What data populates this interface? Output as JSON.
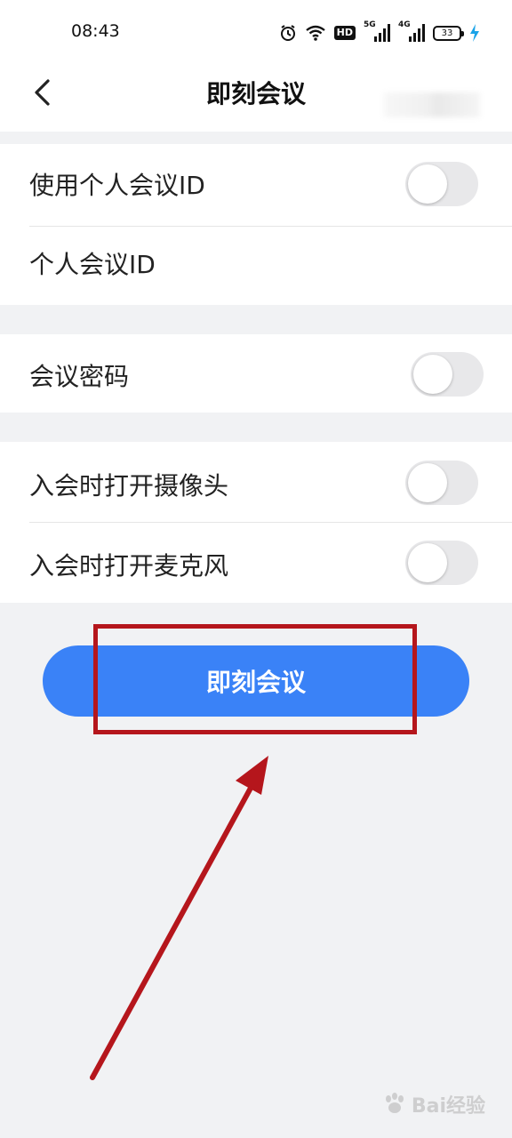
{
  "status_bar": {
    "time": "08:43",
    "hd_label": "HD",
    "signal_1_label": "5G",
    "signal_2_label": "4G",
    "battery_level": "33"
  },
  "navbar": {
    "title": "即刻会议"
  },
  "settings": {
    "use_personal_id_label": "使用个人会议ID",
    "use_personal_id_on": false,
    "personal_id_label": "个人会议ID",
    "password_label": "会议密码",
    "password_on": false,
    "camera_label": "入会时打开摄像头",
    "camera_on": false,
    "mic_label": "入会时打开麦克风",
    "mic_on": false
  },
  "start_button": {
    "label": "即刻会议"
  },
  "watermark": {
    "text": "Bai经验"
  },
  "colors": {
    "primary": "#3a82f7",
    "annotation": "#b5161c",
    "background": "#f1f2f4"
  }
}
